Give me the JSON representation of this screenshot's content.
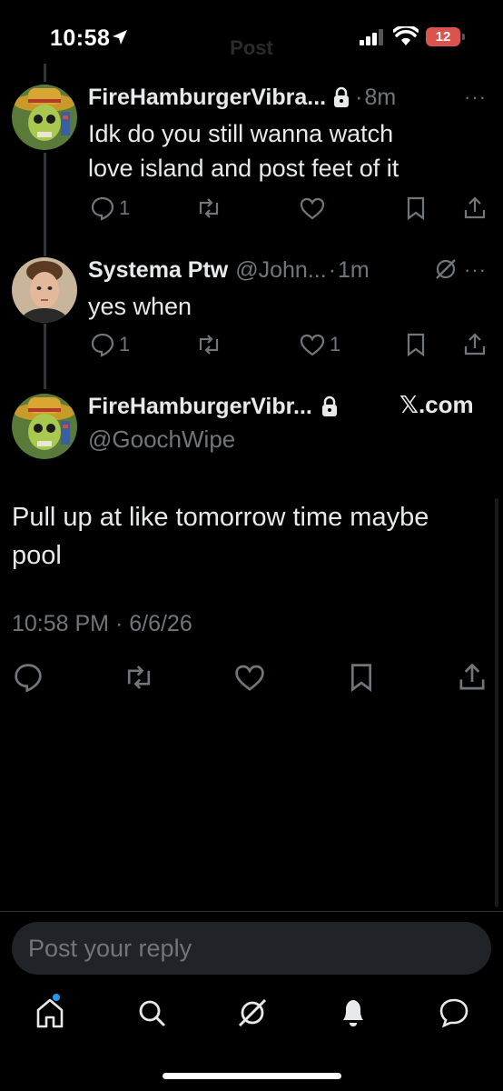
{
  "status_bar": {
    "time": "10:58",
    "battery": "12",
    "screen_title": "Post"
  },
  "thread": [
    {
      "name": "FireHamburgerVibra...",
      "handle": "",
      "separator": "·",
      "time": "8m",
      "text_lines": [
        "Idk do you still wanna watch",
        "love island and post feet of it"
      ],
      "reply_count": "1",
      "repost_count": "",
      "like_count": ""
    },
    {
      "name": "Systema Ptw",
      "handle": "@John...",
      "separator": "·",
      "time": "1m",
      "text_lines": [
        "yes when"
      ],
      "reply_count": "1",
      "repost_count": "",
      "like_count": "1"
    }
  ],
  "main_post": {
    "name": "FireHamburgerVibr...",
    "handle": "@GoochWipe",
    "source": "𝕏.com",
    "text": "Pull up at like tomorrow time maybe pool",
    "timestamp": "10:58 PM · 6/6/26"
  },
  "reply_box": {
    "placeholder": "Post your reply"
  },
  "tabbar": [
    "home-icon",
    "search-icon",
    "grok-icon",
    "notifications-icon",
    "messages-icon"
  ],
  "colors": {
    "background": "#000000",
    "text": "#e7e9ea",
    "muted": "#71767b",
    "accent": "#1d9bf0"
  }
}
